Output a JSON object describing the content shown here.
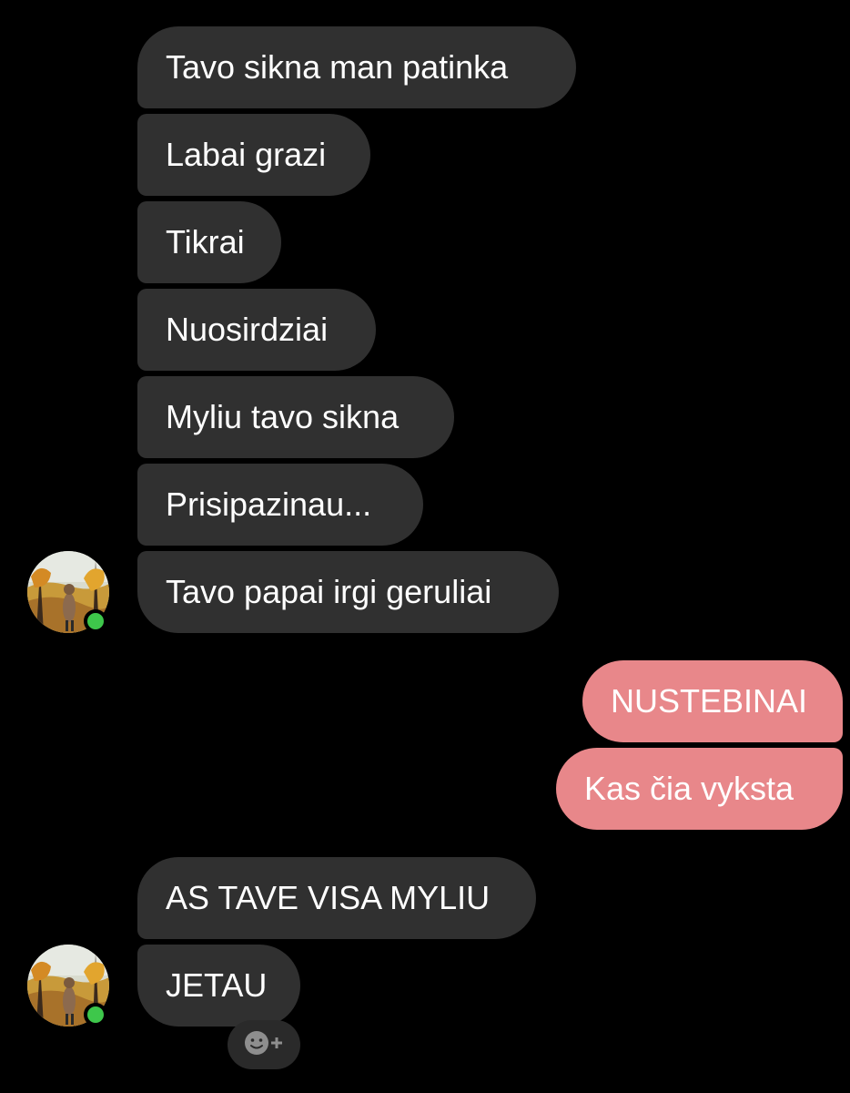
{
  "messages": [
    {
      "text": "Tavo sikna man patinka",
      "direction": "incoming"
    },
    {
      "text": "Labai grazi",
      "direction": "incoming"
    },
    {
      "text": "Tikrai",
      "direction": "incoming"
    },
    {
      "text": "Nuosirdziai",
      "direction": "incoming"
    },
    {
      "text": "Myliu tavo sikna",
      "direction": "incoming"
    },
    {
      "text": "Prisipazinau...",
      "direction": "incoming"
    },
    {
      "text": "Tavo papai irgi geruliai",
      "direction": "incoming"
    },
    {
      "text": "NUSTEBINAI",
      "direction": "outgoing"
    },
    {
      "text": "Kas čia vyksta",
      "direction": "outgoing"
    },
    {
      "text": "AS TAVE VISA MYLIU",
      "direction": "incoming"
    },
    {
      "text": "JETAU",
      "direction": "incoming"
    }
  ],
  "contact": {
    "status": "online"
  },
  "reaction_button": {
    "icon": "add-reaction-icon"
  },
  "colors": {
    "background": "#000000",
    "incoming_bubble": "#303030",
    "outgoing_bubble": "#e8878a",
    "online": "#3ec74b"
  }
}
